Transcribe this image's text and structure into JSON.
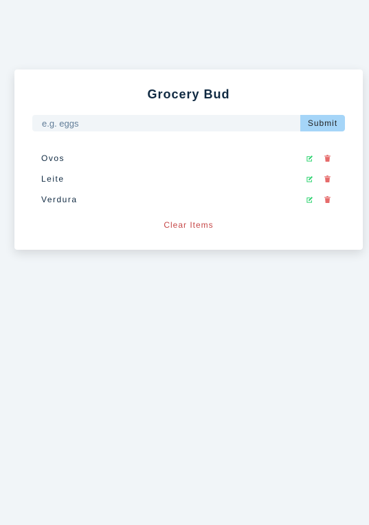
{
  "app": {
    "title": "Grocery Bud"
  },
  "form": {
    "placeholder": "e.g. eggs",
    "submit_label": "Submit"
  },
  "items": [
    {
      "name": "Ovos",
      "edit_icon": "edit-icon",
      "delete_icon": "trash-icon"
    },
    {
      "name": "Leite",
      "edit_icon": "edit-icon",
      "delete_icon": "trash-icon"
    },
    {
      "name": "Verdura",
      "edit_icon": "edit-icon",
      "delete_icon": "trash-icon"
    }
  ],
  "clear_label": "Clear Items",
  "colors": {
    "background": "#f1f5f8",
    "card": "#ffffff",
    "title": "#102a42",
    "submit_bg": "#a5d5f8",
    "edit": "#2cd36f",
    "delete": "#e66b6b",
    "clear": "#bb2525"
  }
}
